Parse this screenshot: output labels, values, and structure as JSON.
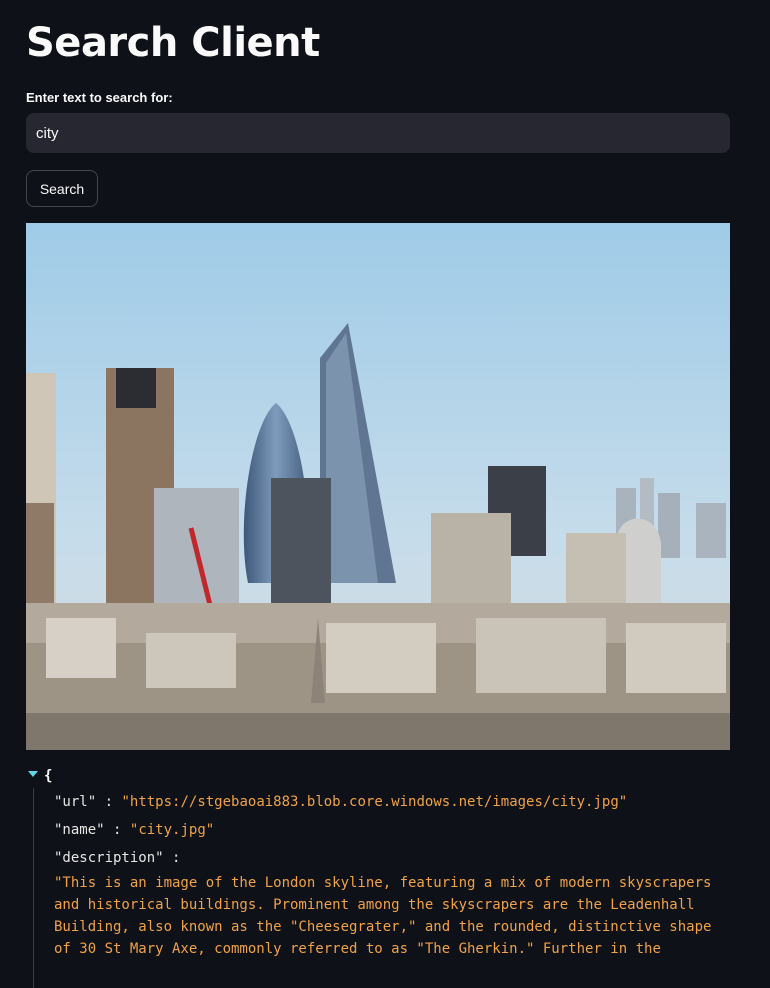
{
  "app": {
    "title": "Search Client",
    "search_label": "Enter text to search for:",
    "search_value": "city",
    "search_button": "Search"
  },
  "result": {
    "open_brace": "{",
    "url_key": "\"url\"",
    "url_value": "\"https://stgebaoai883.blob.core.windows.net/images/city.jpg\"",
    "name_key": "\"name\"",
    "name_value": "\"city.jpg\"",
    "description_key": "\"description\"",
    "description_value": "\"This is an image of the London skyline, featuring a mix of modern skyscrapers and historical buildings. Prominent among the skyscrapers are the Leadenhall Building, also known as the \"Cheesegrater,\" and the rounded, distinctive shape of 30 St Mary Axe, commonly referred to as \"The Gherkin.\" Further in the",
    "colon": ":"
  },
  "colors": {
    "background": "#0e1117",
    "input_bg": "#262730",
    "string": "#f0a24a",
    "caret": "#5fd7e6"
  }
}
